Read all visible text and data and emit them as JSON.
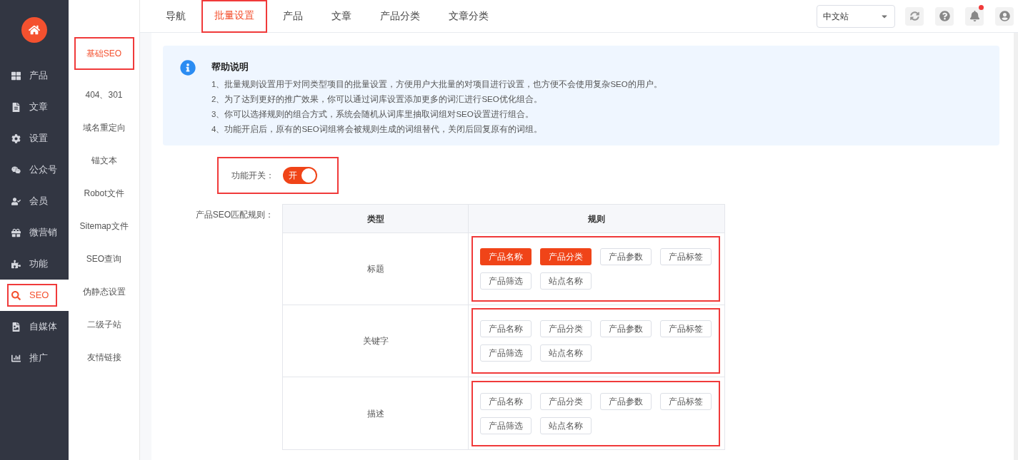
{
  "sidebar": {
    "items": [
      {
        "label": "产品",
        "selected": false,
        "highlighted": false
      },
      {
        "label": "文章",
        "selected": false,
        "highlighted": false
      },
      {
        "label": "设置",
        "selected": false,
        "highlighted": false
      },
      {
        "label": "公众号",
        "selected": false,
        "highlighted": false
      },
      {
        "label": "会员",
        "selected": false,
        "highlighted": false
      },
      {
        "label": "微营销",
        "selected": false,
        "highlighted": false
      },
      {
        "label": "功能",
        "selected": false,
        "highlighted": false
      },
      {
        "label": "SEO",
        "selected": true,
        "highlighted": true
      },
      {
        "label": "自媒体",
        "selected": false,
        "highlighted": false
      },
      {
        "label": "推广",
        "selected": false,
        "highlighted": false
      }
    ]
  },
  "subnav": {
    "items": [
      {
        "label": "基础SEO",
        "selected": true,
        "highlighted": true
      },
      {
        "label": "404、301",
        "selected": false,
        "highlighted": false
      },
      {
        "label": "域名重定向",
        "selected": false,
        "highlighted": false
      },
      {
        "label": "锚文本",
        "selected": false,
        "highlighted": false
      },
      {
        "label": "Robot文件",
        "selected": false,
        "highlighted": false
      },
      {
        "label": "Sitemap文件",
        "selected": false,
        "highlighted": false
      },
      {
        "label": "SEO查询",
        "selected": false,
        "highlighted": false
      },
      {
        "label": "伪静态设置",
        "selected": false,
        "highlighted": false
      },
      {
        "label": "二级子站",
        "selected": false,
        "highlighted": false
      },
      {
        "label": "友情链接",
        "selected": false,
        "highlighted": false
      }
    ]
  },
  "tabs": [
    {
      "label": "导航",
      "selected": false,
      "highlighted": false
    },
    {
      "label": "批量设置",
      "selected": true,
      "highlighted": true
    },
    {
      "label": "产品",
      "selected": false,
      "highlighted": false
    },
    {
      "label": "文章",
      "selected": false,
      "highlighted": false
    },
    {
      "label": "产品分类",
      "selected": false,
      "highlighted": false
    },
    {
      "label": "文章分类",
      "selected": false,
      "highlighted": false
    }
  ],
  "site_select": {
    "value": "中文站"
  },
  "notification_badge": true,
  "help": {
    "title": "帮助说明",
    "lines": [
      "1、批量规则设置用于对同类型项目的批量设置，方便用户大批量的对项目进行设置，也方便不会使用复杂SEO的用户。",
      "2、为了达到更好的推广效果，你可以通过词库设置添加更多的词汇进行SEO优化组合。",
      "3、你可以选择规则的组合方式，系统会随机从词库里抽取词组对SEO设置进行组合。",
      "4、功能开启后，原有的SEO词组将会被规则生成的词组替代，关闭后回复原有的词组。"
    ]
  },
  "feature_switch": {
    "label": "功能开关：",
    "on": true,
    "on_text": "开",
    "highlighted": true
  },
  "rules": {
    "label": "产品SEO匹配规则：",
    "columns": [
      "类型",
      "规则"
    ],
    "rows": [
      {
        "type": "标题",
        "highlighted": true,
        "tags": [
          {
            "label": "产品名称",
            "selected": true
          },
          {
            "label": "产品分类",
            "selected": true
          },
          {
            "label": "产品参数",
            "selected": false
          },
          {
            "label": "产品标签",
            "selected": false
          },
          {
            "label": "产品筛选",
            "selected": false
          },
          {
            "label": "站点名称",
            "selected": false
          }
        ]
      },
      {
        "type": "关键字",
        "highlighted": true,
        "tags": [
          {
            "label": "产品名称",
            "selected": false
          },
          {
            "label": "产品分类",
            "selected": false
          },
          {
            "label": "产品参数",
            "selected": false
          },
          {
            "label": "产品标签",
            "selected": false
          },
          {
            "label": "产品筛选",
            "selected": false
          },
          {
            "label": "站点名称",
            "selected": false
          }
        ]
      },
      {
        "type": "描述",
        "highlighted": true,
        "tags": [
          {
            "label": "产品名称",
            "selected": false
          },
          {
            "label": "产品分类",
            "selected": false
          },
          {
            "label": "产品参数",
            "selected": false
          },
          {
            "label": "产品标签",
            "selected": false
          },
          {
            "label": "产品筛选",
            "selected": false
          },
          {
            "label": "站点名称",
            "selected": false
          }
        ]
      }
    ]
  }
}
